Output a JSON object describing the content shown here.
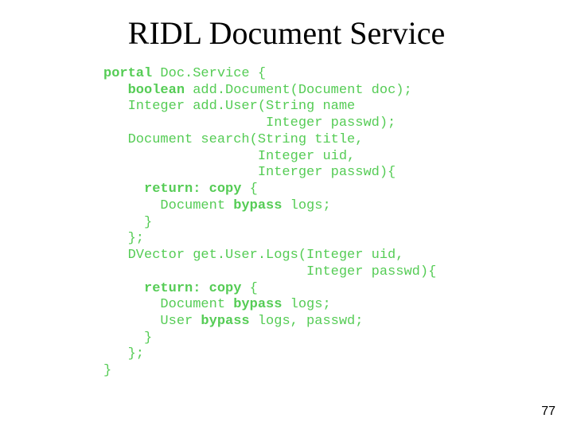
{
  "title": "RIDL Document Service",
  "code": {
    "l01a": "portal",
    "l01b": " Doc.Service {",
    "l02a": "   ",
    "l02b": "boolean",
    "l02c": " add.Document(Document doc);",
    "l03": "   Integer add.User(String name",
    "l04": "                    Integer passwd);",
    "l05": "   Document search(String title,",
    "l06": "                   Integer uid,",
    "l07": "                   Interger passwd){",
    "l08a": "     ",
    "l08b": "return: copy",
    "l08c": " {",
    "l09a": "       Document ",
    "l09b": "bypass",
    "l09c": " logs;",
    "l10": "     }",
    "l11": "   };",
    "l12": "   DVector get.User.Logs(Integer uid,",
    "l13": "                         Integer passwd){",
    "l14a": "     ",
    "l14b": "return: copy",
    "l14c": " {",
    "l15a": "       Document ",
    "l15b": "bypass",
    "l15c": " logs;",
    "l16a": "       User ",
    "l16b": "bypass",
    "l16c": " logs, passwd;",
    "l17": "     }",
    "l18": "   };",
    "l19": "}"
  },
  "page_number": "77"
}
